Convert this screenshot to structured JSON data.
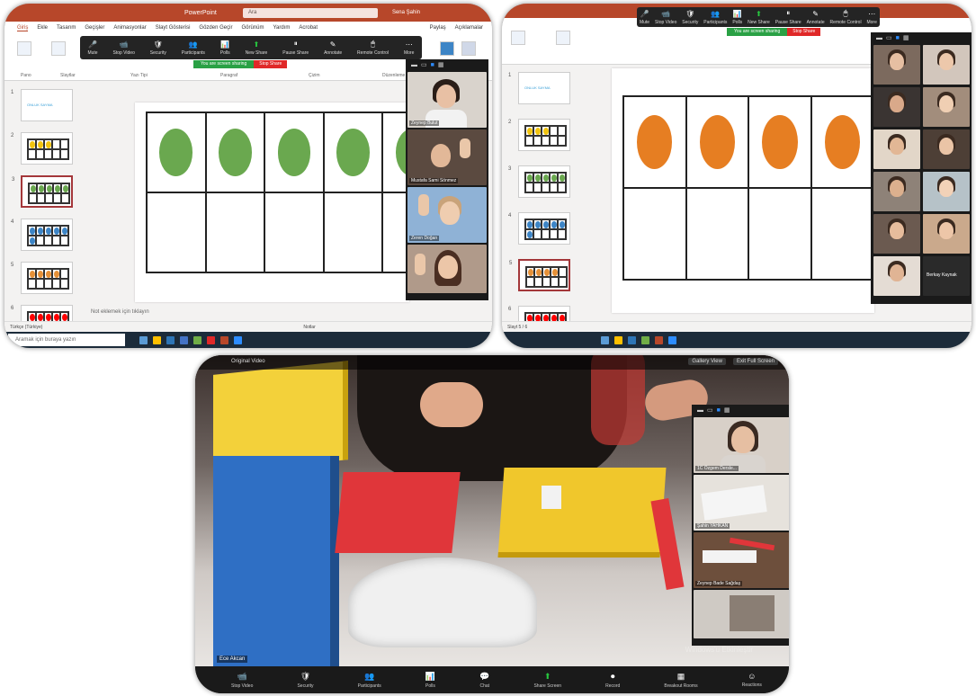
{
  "screen1": {
    "window_title": "PowerPoint",
    "search_placeholder": "Ara",
    "user_name": "Sena Şahin",
    "tabs": [
      "Giriş",
      "Ekle",
      "Tasarım",
      "Geçişler",
      "Animasyonlar",
      "Slayt Gösterisi",
      "Gözden Geçir",
      "Görünüm",
      "Yardım",
      "Acrobat"
    ],
    "share_label": "Paylaş",
    "comments_label": "Açıklamalar",
    "ribbon_groups": [
      "Pano",
      "Slaytlar",
      "Yazı Tipi",
      "Paragraf",
      "Çizim",
      "Düzenleme"
    ],
    "zoom_toolbar": [
      "Mute",
      "Stop Video",
      "Security",
      "Participants",
      "Polls",
      "New Share",
      "Pause Share",
      "Annotate",
      "Remote Control",
      "More"
    ],
    "participants_count": "20",
    "sharing_text": "You are screen sharing",
    "stop_share": "Stop Share",
    "thumb_caption": "ONLUK SAYMA",
    "thumbs": [
      {
        "num": "1",
        "color": "",
        "count": 0
      },
      {
        "num": "2",
        "color": "#f2c40f",
        "count": 3
      },
      {
        "num": "3",
        "color": "#6aa84f",
        "count": 5
      },
      {
        "num": "4",
        "color": "#3d85c6",
        "count": 6
      },
      {
        "num": "5",
        "color": "#e69138",
        "count": 4
      },
      {
        "num": "6",
        "color": "#ff0000",
        "count": 5
      }
    ],
    "slide_dot_color": "#6aa84f",
    "slide_dot_count": 5,
    "notes_text": "Not eklemek için tıklayın",
    "status_left": "Türkçe (Türkiye)",
    "status_right": "Notlar",
    "taskbar_search": "Aramak için buraya yazın",
    "gallery_names": [
      "Zeynep Bulut",
      "Mustafa Sami Sönmez",
      "Zeren Doğan",
      ""
    ]
  },
  "screen2": {
    "zoom_toolbar": [
      "Mute",
      "Stop Video",
      "Security",
      "Participants",
      "Polls",
      "New Share",
      "Pause Share",
      "Annotate",
      "Remote Control",
      "More"
    ],
    "sharing_text": "You are screen sharing",
    "stop_share": "Stop Share",
    "thumb_caption": "ONLUK SAYMA",
    "thumbs": [
      {
        "num": "1",
        "color": "",
        "count": 0
      },
      {
        "num": "2",
        "color": "#f2c40f",
        "count": 3
      },
      {
        "num": "3",
        "color": "#6aa84f",
        "count": 5
      },
      {
        "num": "4",
        "color": "#3d85c6",
        "count": 6
      },
      {
        "num": "5",
        "color": "#e69138",
        "count": 4
      },
      {
        "num": "6",
        "color": "#ff0000",
        "count": 5
      }
    ],
    "slide_dot_color": "#e67e22",
    "slide_dot_count": 4,
    "gallery_last_name": "Berkay Kaynak",
    "status_left": "Slayt 5 / 6"
  },
  "screen3": {
    "top_title": "Original Video",
    "gallery_view": "Gallery View",
    "exit_full": "Exit Full Screen",
    "speaker_name": "Ece Akcan",
    "watermark": "Windows'u Etkinleştir",
    "toolbar": [
      "Stop Video",
      "Security",
      "Participants",
      "Polls",
      "Chat",
      "Share Screen",
      "Record",
      "Breakout Rooms",
      "Reactions"
    ],
    "participants_count": "25",
    "gallery_names": [
      "1C Özgem Dersle...",
      "Şahin YAHKAN",
      "Zeynep Bade Sağdaş",
      ""
    ]
  },
  "colors": {
    "ppt_red": "#b7472a",
    "zoom_bar": "#242424",
    "share_green": "#2aa145",
    "stop_red": "#e02828"
  }
}
